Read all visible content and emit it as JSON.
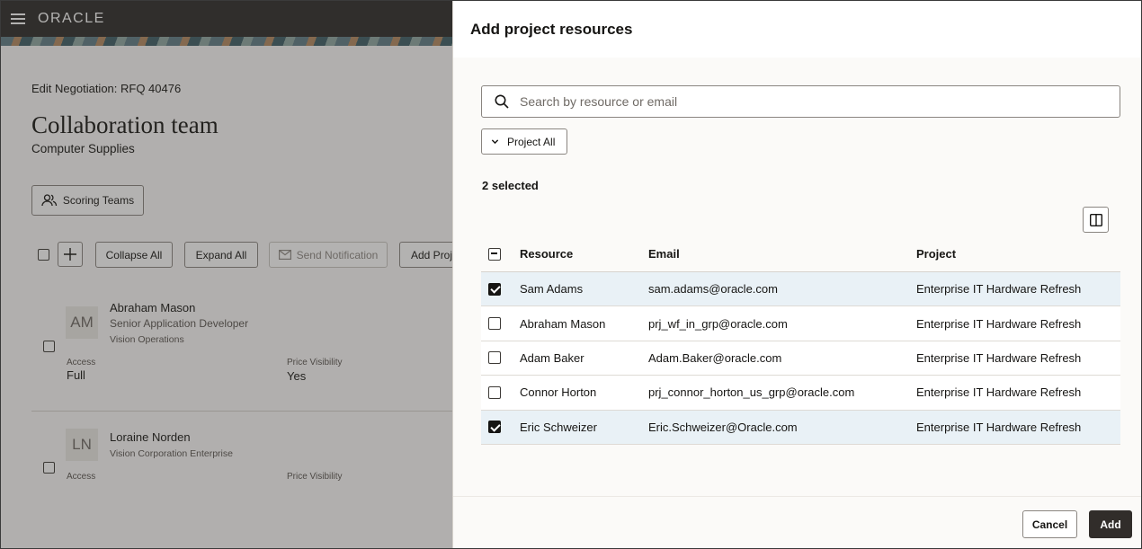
{
  "app": {
    "logo_text": "ORACLE"
  },
  "background": {
    "edit_negotiation": "Edit Negotiation: RFQ 40476",
    "title": "Collaboration team",
    "subtitle": "Computer Supplies",
    "scoring_teams_label": "Scoring Teams",
    "toolbar": {
      "collapse_all": "Collapse All",
      "expand_all": "Expand All",
      "send_notification": "Send Notification",
      "add_project": "Add Proje"
    },
    "members": [
      {
        "initials": "AM",
        "name": "Abraham Mason",
        "role": "Senior Application Developer",
        "org": "Vision Operations",
        "access_label": "Access",
        "access_value": "Full",
        "price_visibility_label": "Price Visibility",
        "price_visibility_value": "Yes"
      },
      {
        "initials": "LN",
        "name": "Loraine Norden",
        "role": "Vision Corporation Enterprise",
        "access_label": "Access",
        "price_visibility_label": "Price Visibility"
      }
    ]
  },
  "drawer": {
    "title": "Add project resources",
    "search": {
      "placeholder": "Search by resource or email",
      "value": ""
    },
    "filter_label": "Project All",
    "selected_count": "2 selected",
    "columns": {
      "resource": "Resource",
      "email": "Email",
      "project": "Project"
    },
    "rows": [
      {
        "resource": "Sam Adams",
        "email": "sam.adams@oracle.com",
        "project": "Enterprise IT Hardware Refresh",
        "selected": true
      },
      {
        "resource": "Abraham Mason",
        "email": "prj_wf_in_grp@oracle.com",
        "project": "Enterprise IT Hardware Refresh",
        "selected": false
      },
      {
        "resource": "Adam Baker",
        "email": "Adam.Baker@oracle.com",
        "project": "Enterprise IT Hardware Refresh",
        "selected": false
      },
      {
        "resource": "Connor Horton",
        "email": "prj_connor_horton_us_grp@oracle.com",
        "project": "Enterprise IT Hardware Refresh",
        "selected": false
      },
      {
        "resource": "Eric Schweizer",
        "email": "Eric.Schweizer@Oracle.com",
        "project": "Enterprise IT Hardware Refresh",
        "selected": true
      }
    ],
    "cancel_label": "Cancel",
    "add_label": "Add"
  }
}
